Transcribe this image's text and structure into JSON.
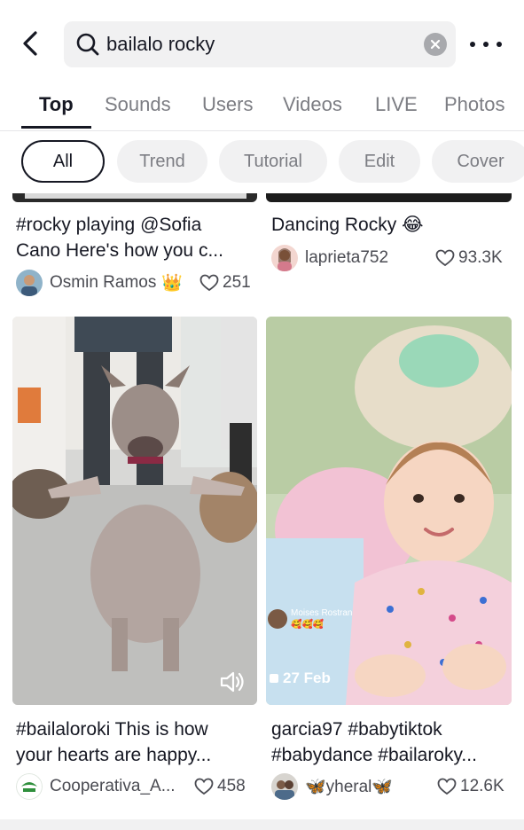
{
  "search": {
    "query": "bailalo rocky"
  },
  "tabs": [
    {
      "label": "Top"
    },
    {
      "label": "Sounds"
    },
    {
      "label": "Users"
    },
    {
      "label": "Videos"
    },
    {
      "label": "LIVE"
    },
    {
      "label": "Photos"
    }
  ],
  "filters": [
    {
      "label": "All"
    },
    {
      "label": "Trend"
    },
    {
      "label": "Tutorial"
    },
    {
      "label": "Edit"
    },
    {
      "label": "Cover"
    }
  ],
  "results": [
    {
      "caption_line1": "#rocky playing @Sofia",
      "caption_line2": "Cano Here's how you c...",
      "author": "Osmin Ramos",
      "author_badge": "👑",
      "likes": "251"
    },
    {
      "caption_line1": "Dancing Rocky 😂",
      "author": "laprieta752",
      "likes": "93.3K"
    },
    {
      "caption_line1": "#bailaloroki This is how",
      "caption_line2": "your hearts are happy...",
      "author": "Cooperativa_A...",
      "likes": "458",
      "sound_icon": "speaker-icon"
    },
    {
      "caption_line1": "garcia97 #babytiktok",
      "caption_line2": "#babydance #bailaroky...",
      "author": "🦋yheral🦋",
      "likes": "12.6K",
      "date_badge": "27 Feb",
      "overlay_user": "Moises  Rostran",
      "overlay_emoji": "🥰🥰🥰"
    }
  ],
  "colors": {
    "text": "#161823",
    "muted": "#7c7d83",
    "chip_bg": "#f1f1f2"
  }
}
